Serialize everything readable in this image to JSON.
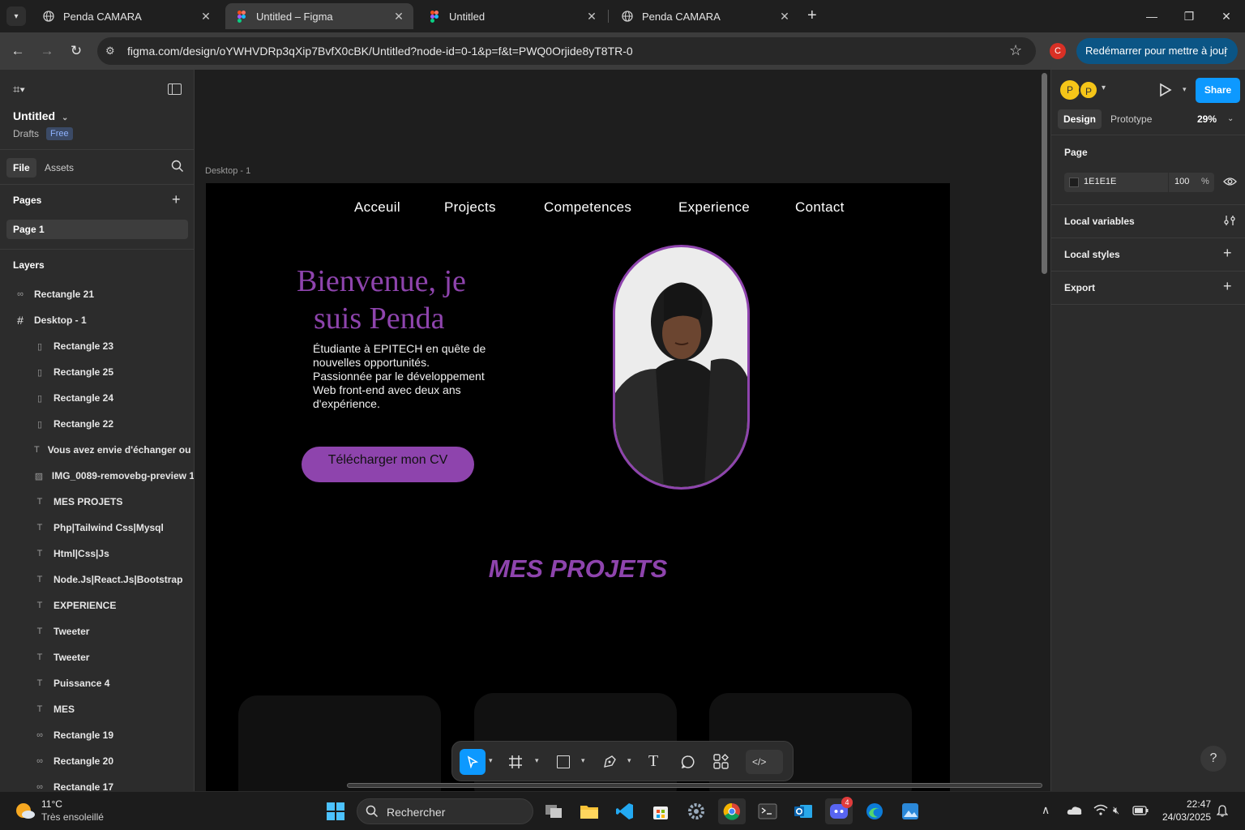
{
  "browser": {
    "tabs": [
      {
        "title": "Penda CAMARA",
        "active": false
      },
      {
        "title": "Untitled – Figma",
        "active": true
      },
      {
        "title": "Untitled",
        "active": false
      },
      {
        "title": "Penda CAMARA",
        "active": false
      }
    ],
    "url": "figma.com/design/oYWHVDRp3qXip7BvfX0cBK/Untitled?node-id=0-1&p=f&t=PWQ0Orjide8yT8TR-0",
    "profile_initial": "C",
    "update_button": "Redémarrer pour mettre à jour"
  },
  "left_panel": {
    "file_name": "Untitled",
    "location": "Drafts",
    "plan_badge": "Free",
    "tabs": [
      "File",
      "Assets"
    ],
    "pages_heading": "Pages",
    "pages": [
      "Page 1"
    ],
    "layers_heading": "Layers",
    "layers": [
      {
        "name": "Rectangle 21",
        "icon": "link-icon",
        "depth": 0
      },
      {
        "name": "Desktop - 1",
        "icon": "frame-icon",
        "depth": 0
      },
      {
        "name": "Rectangle 23",
        "icon": "rectangle-icon",
        "depth": 1
      },
      {
        "name": "Rectangle 25",
        "icon": "rectangle-icon",
        "depth": 1
      },
      {
        "name": "Rectangle 24",
        "icon": "rectangle-icon",
        "depth": 1
      },
      {
        "name": "Rectangle 22",
        "icon": "rectangle-icon",
        "depth": 1
      },
      {
        "name": "Vous avez envie d'échanger ou si",
        "icon": "text-icon",
        "depth": 1
      },
      {
        "name": "IMG_0089-removebg-preview 1",
        "icon": "image-icon",
        "depth": 1
      },
      {
        "name": "MES PROJETS",
        "icon": "text-icon",
        "depth": 1
      },
      {
        "name": "Php|Tailwind Css|Mysql",
        "icon": "text-icon",
        "depth": 1
      },
      {
        "name": "Html|Css|Js",
        "icon": "text-icon",
        "depth": 1
      },
      {
        "name": "Node.Js|React.Js|Bootstrap",
        "icon": "text-icon",
        "depth": 1
      },
      {
        "name": "EXPERIENCE",
        "icon": "text-icon",
        "depth": 1
      },
      {
        "name": "Tweeter",
        "icon": "text-icon",
        "depth": 1
      },
      {
        "name": "Tweeter",
        "icon": "text-icon",
        "depth": 1
      },
      {
        "name": "Puissance 4",
        "icon": "text-icon",
        "depth": 1
      },
      {
        "name": "MES",
        "icon": "text-icon",
        "depth": 1
      },
      {
        "name": "Rectangle 19",
        "icon": "link-icon",
        "depth": 1
      },
      {
        "name": "Rectangle 20",
        "icon": "link-icon",
        "depth": 1
      },
      {
        "name": "Rectangle 17",
        "icon": "link-icon",
        "depth": 1
      }
    ]
  },
  "canvas": {
    "frame_label": "Desktop - 1",
    "nav": [
      "Acceuil",
      "Projects",
      "Competences",
      "Experience",
      "Contact"
    ],
    "hero_title_line1": "Bienvenue, je",
    "hero_title_line2": "suis Penda",
    "hero_text": [
      "Étudiante à EPITECH en quête de",
      "nouvelles opportunités.",
      "Passionnée par le développement",
      "Web front-end avec deux ans",
      "d'expérience."
    ],
    "cv_button": "Télécharger mon CV",
    "projects_heading": "MES PROJETS",
    "accent_color": "#8e44ad"
  },
  "right_panel": {
    "avatars": [
      "P",
      "P"
    ],
    "share": "Share",
    "tabs": [
      "Design",
      "Prototype"
    ],
    "zoom": "29%",
    "page_heading": "Page",
    "page_color": "1E1E1E",
    "page_opacity": "100",
    "percent": "%",
    "sections": [
      "Local variables",
      "Local styles",
      "Export"
    ]
  },
  "toolbar_tools": [
    "move-tool",
    "frame-tool",
    "rectangle-tool",
    "pen-tool",
    "text-tool",
    "comment-tool",
    "components-tool",
    "dev-mode-tool"
  ],
  "taskbar": {
    "weather_temp": "11°C",
    "weather_desc": "Très ensoleillé",
    "search_placeholder": "Rechercher",
    "time": "22:47",
    "date": "24/03/2025",
    "discord_badge": "4"
  }
}
